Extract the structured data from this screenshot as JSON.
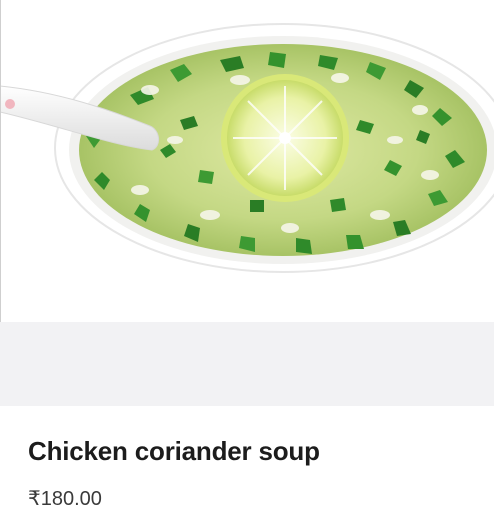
{
  "product": {
    "image_subject": "soup-bowl-image",
    "name": "Chicken coriander soup",
    "price": "₹180.00"
  },
  "colors": {
    "background": "#ffffff",
    "band": "#f2f2f4",
    "title_text": "#1c1c1c",
    "price_text": "#3a3a3a",
    "soup_base": "#c9d98a",
    "herb_green": "#2f8a2a",
    "lemon": "#e8f0a0"
  }
}
